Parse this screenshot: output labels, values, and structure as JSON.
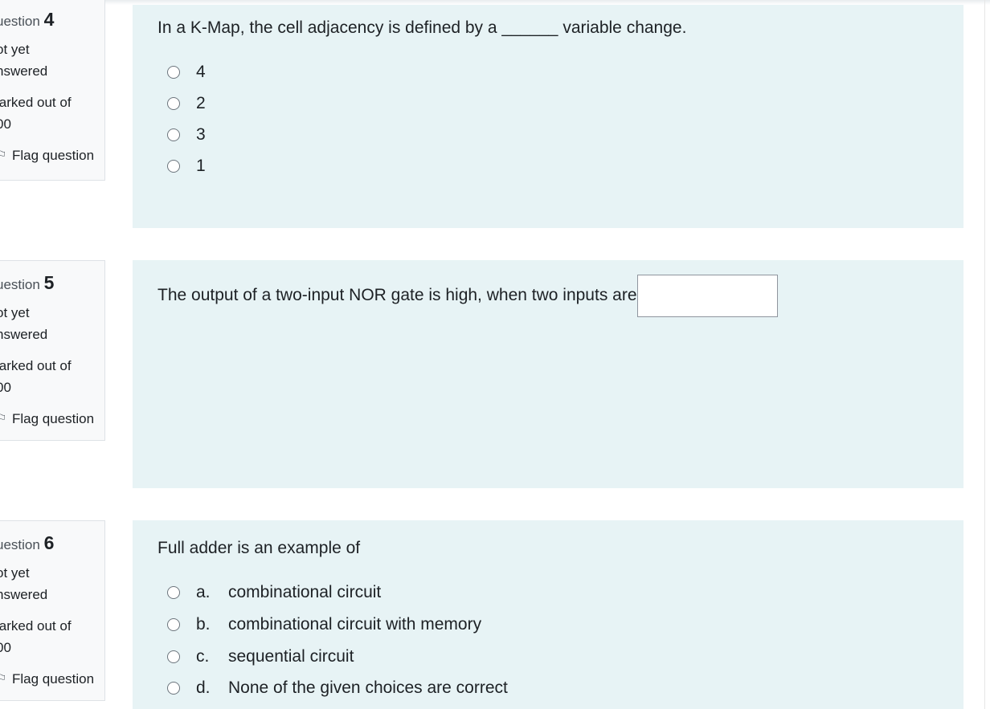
{
  "questions": [
    {
      "info": {
        "label": "uestion",
        "number": "4",
        "state_line1": "ot yet",
        "state_line2": "nswered",
        "grade_line1": "larked out of",
        "grade_line2": "00",
        "flag_label": "Flag question"
      },
      "text": "In a K-Map, the cell adjacency is defined by a ______ variable change.",
      "options": [
        {
          "label": "4"
        },
        {
          "label": "2"
        },
        {
          "label": "3"
        },
        {
          "label": "1"
        }
      ]
    },
    {
      "info": {
        "label": "uestion",
        "number": "5",
        "state_line1": "ot yet",
        "state_line2": "nswered",
        "grade_line1": "larked out of",
        "grade_line2": "00",
        "flag_label": "Flag question"
      },
      "text": "The output of a two-input NOR gate is high, when two inputs are",
      "answer_value": ""
    },
    {
      "info": {
        "label": "uestion",
        "number": "6",
        "state_line1": "ot yet",
        "state_line2": "nswered",
        "grade_line1": "larked out of",
        "grade_line2": "00",
        "flag_label": "Flag question"
      },
      "text": "Full adder is an example of",
      "options": [
        {
          "letter": "a.",
          "label": "combinational circuit"
        },
        {
          "letter": "b.",
          "label": "combinational circuit with memory"
        },
        {
          "letter": "c.",
          "label": "sequential circuit"
        },
        {
          "letter": "d.",
          "label": "None of the given choices are correct"
        }
      ]
    }
  ],
  "icons": {
    "flag": "flag-icon",
    "radio": "radio-button"
  },
  "colors": {
    "content_bg": "#e7f3f5",
    "info_bg": "#f8f9fa"
  }
}
